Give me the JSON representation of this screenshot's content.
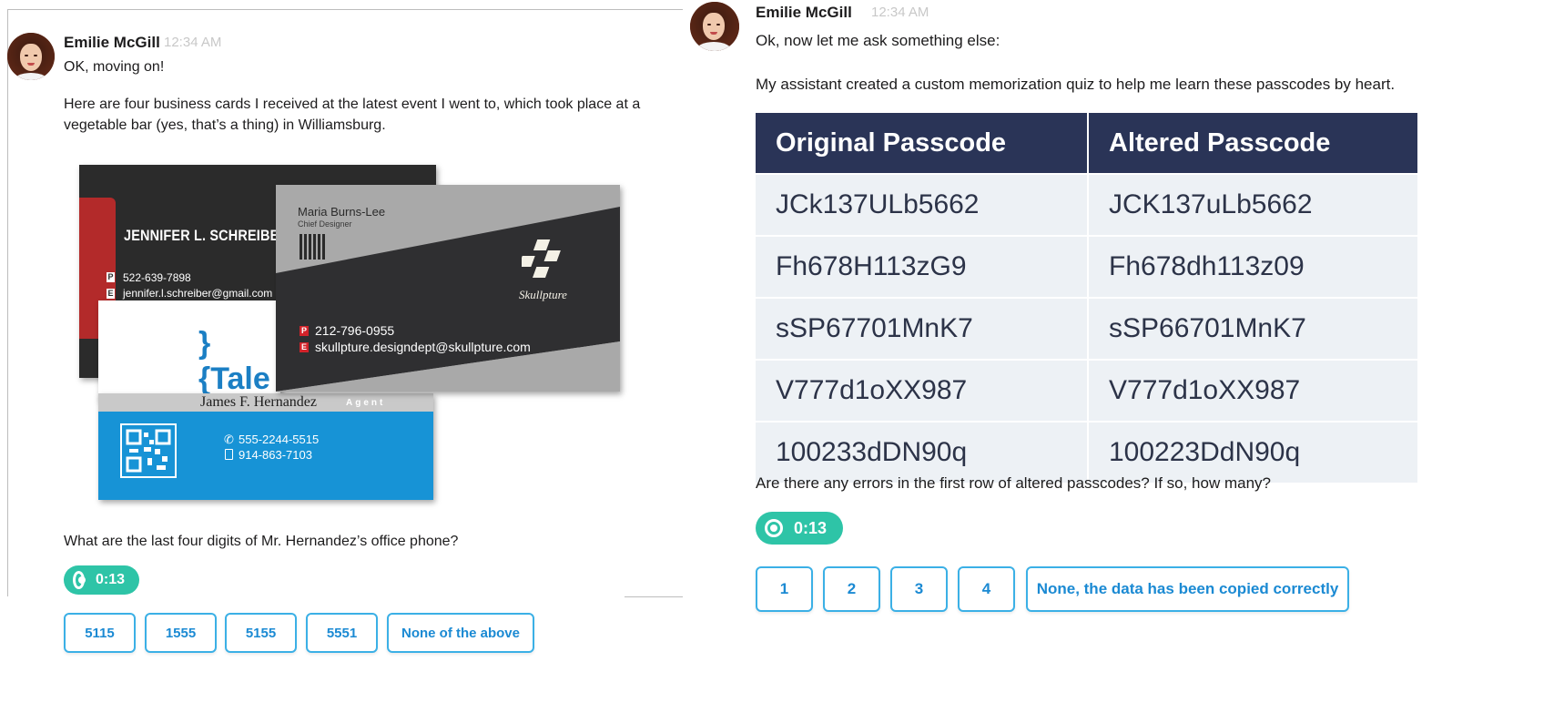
{
  "left": {
    "sender": "Emilie McGill",
    "time": "12:34 AM",
    "line1": "OK, moving on!",
    "line2a": "Here are four business cards I received at the latest event I went to, which took place at a",
    "line2b": "vegetable bar (yes, that’s a thing) in Williamsburg.",
    "cards": {
      "schreiber": {
        "name": "JENNIFER L. SCHREIBER",
        "p_tag": "P",
        "e_tag": "E",
        "phone": "522-639-7898",
        "email": "jennifer.l.schreiber@gmail.com"
      },
      "burns_lee": {
        "name": "Maria Burns-Lee",
        "title": "Chief Designer",
        "logo_text": "Skullpture",
        "p_tag": "P",
        "e_tag": "E",
        "phone": "212-796-0955",
        "email": "skullpture.designdept@skullpture.com"
      },
      "tale": {
        "logo": "}{Tale"
      },
      "hernandez": {
        "name": "James F. Hernandez",
        "role": "Agent",
        "phone1": "555-2244-5515",
        "phone2": "914-863-7103"
      }
    },
    "question": "What are the last four digits of Mr. Hernandez’s office phone?",
    "timer": "0:13",
    "options": [
      "5115",
      "1555",
      "5155",
      "5551",
      "None of the above"
    ]
  },
  "right": {
    "sender": "Emilie McGill",
    "time": "12:34 AM",
    "line1": "Ok, now let me ask something else:",
    "line2": "My assistant created a custom memorization quiz to help me learn these passcodes by heart.",
    "table": {
      "headers": [
        "Original Passcode",
        "Altered Passcode"
      ],
      "rows": [
        [
          "JCk137ULb5662",
          "JCK137uLb5662"
        ],
        [
          "Fh678H113zG9",
          "Fh678dh113z09"
        ],
        [
          "sSP67701MnK7",
          "sSP66701MnK7"
        ],
        [
          "V777d1oXX987",
          "V777d1oXX987"
        ],
        [
          "100233dDN90q",
          "100223DdN90q"
        ]
      ]
    },
    "question": "Are there any errors in the first row of altered passcodes? If so, how many?",
    "timer": "0:13",
    "options": [
      "1",
      "2",
      "3",
      "4",
      "None, the data has been copied correctly"
    ]
  }
}
